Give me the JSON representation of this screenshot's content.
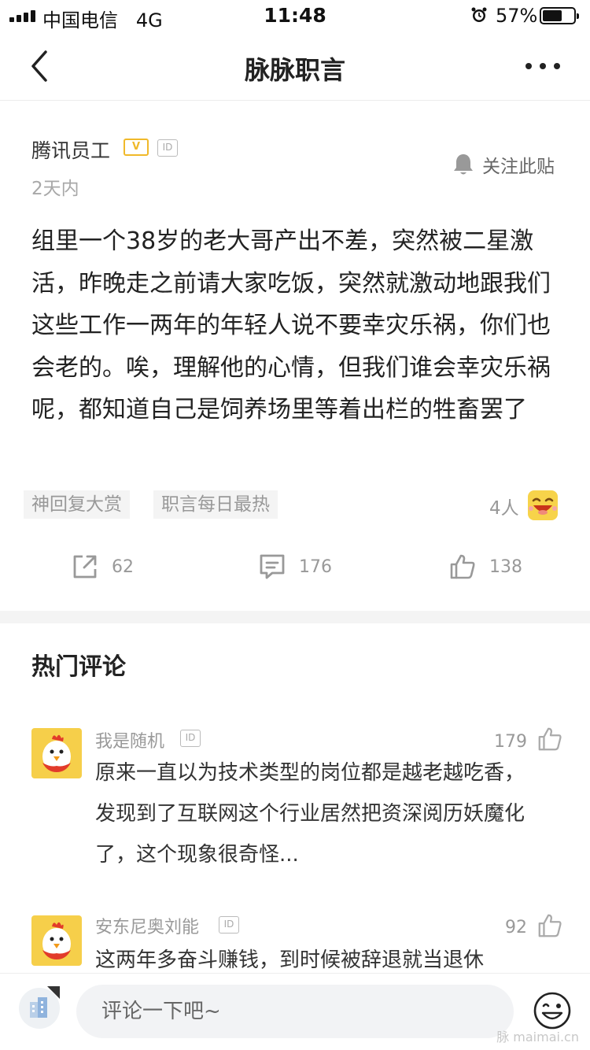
{
  "status_bar": {
    "carrier": "中国电信",
    "network": "4G",
    "time": "11:48",
    "battery": "57%"
  },
  "nav": {
    "title": "脉脉职言"
  },
  "post": {
    "author": "腾讯员工",
    "badge_text": "V",
    "id_badge": "ID",
    "time": "2天内",
    "follow_label": "关注此贴",
    "content": "组里一个38岁的老大哥产出不差，突然被二星激活，昨晚走之前请大家吃饭，突然就激动地跟我们这些工作一两年的年轻人说不要幸灾乐祸，你们也会老的。唉，理解他的心情，但我们谁会幸灾乐祸呢，都知道自己是饲养场里等着出栏的牲畜罢了",
    "tags": [
      "神回复大赏",
      "职言每日最热"
    ],
    "reader_count": "4人",
    "share_count": "62",
    "comment_count": "176",
    "like_count": "138"
  },
  "hot_comments": {
    "title": "热门评论",
    "items": [
      {
        "name": "我是随机",
        "id_badge": "ID",
        "likes": "179",
        "text": "原来一直以为技术类型的岗位都是越老越吃香，发现到了互联网这个行业居然把资深阅历妖魔化了，这个现象很奇怪..."
      },
      {
        "name": "安东尼奥刘能",
        "id_badge": "ID",
        "likes": "92",
        "text": "这两年多奋斗赚钱，到时候被辞退就当退休"
      }
    ]
  },
  "bottom_bar": {
    "comment_placeholder": "评论一下吧~",
    "watermark": "脉 maimai.cn"
  },
  "colors": {
    "badge_gold": "#f0b92a",
    "avatar_yellow": "#f6cf4a",
    "tag_bg": "#f4f4f4",
    "muted_text": "#999999"
  }
}
